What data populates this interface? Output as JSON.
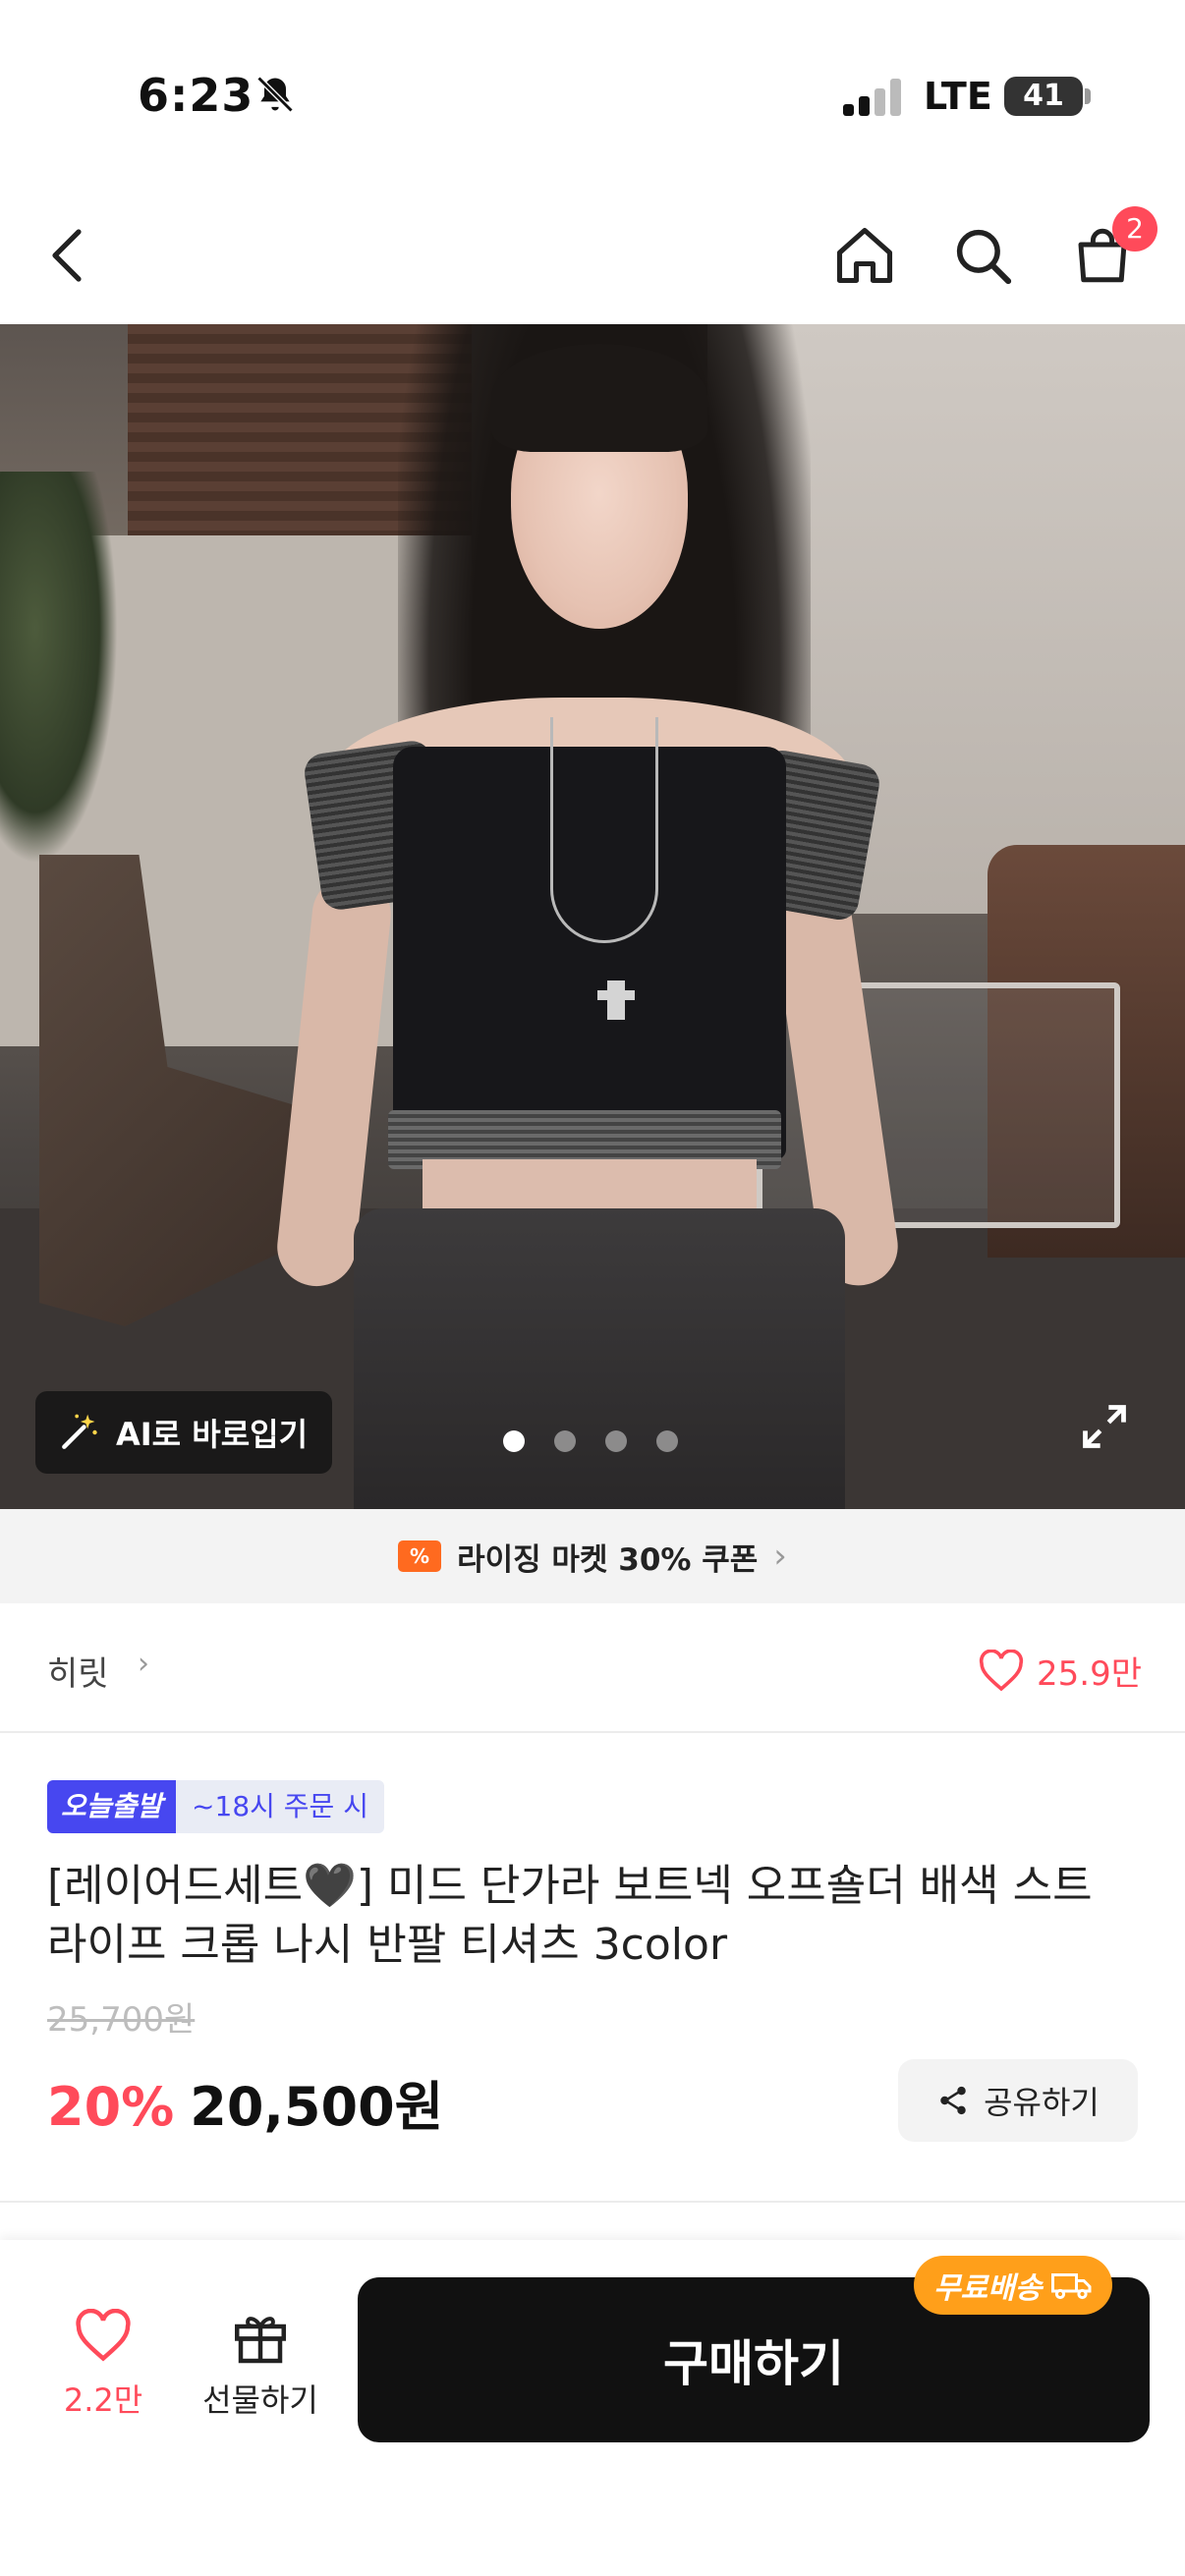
{
  "status_bar": {
    "time": "6:23",
    "network": "LTE",
    "battery": "41"
  },
  "header": {
    "back_icon": "chevron-left-icon",
    "home_icon": "home-icon",
    "search_icon": "search-icon",
    "cart_icon": "shopping-bag-icon",
    "cart_count": "2"
  },
  "gallery": {
    "ai_label": "AI로 바로입기",
    "dots_total": 4,
    "active_dot": 1
  },
  "coupon": {
    "icon_text": "%",
    "text": "라이징 마켓 30% 쿠폰"
  },
  "brand": {
    "name": "히릿",
    "likes": "25.9만"
  },
  "product": {
    "badge_today": "오늘출발",
    "badge_time": "~18시 주문 시",
    "title": "[레이어드세트🖤] 미드 단가라 보트넥 오프숄더 배색 스트라이프 크롭 나시 반팔 티셔츠 3color",
    "original_price": "25,700원",
    "discount": "20%",
    "price": "20,500원",
    "share_label": "공유하기"
  },
  "bottom_bar": {
    "like_count": "2.2만",
    "gift_label": "선물하기",
    "buy_label": "구매하기",
    "free_shipping": "무료배송"
  },
  "colors": {
    "accent_red": "#ff4a5a",
    "today_blue": "#4747f0",
    "coupon_orange": "#ff6a1f",
    "shipping_orange": "#ff9f1a"
  }
}
